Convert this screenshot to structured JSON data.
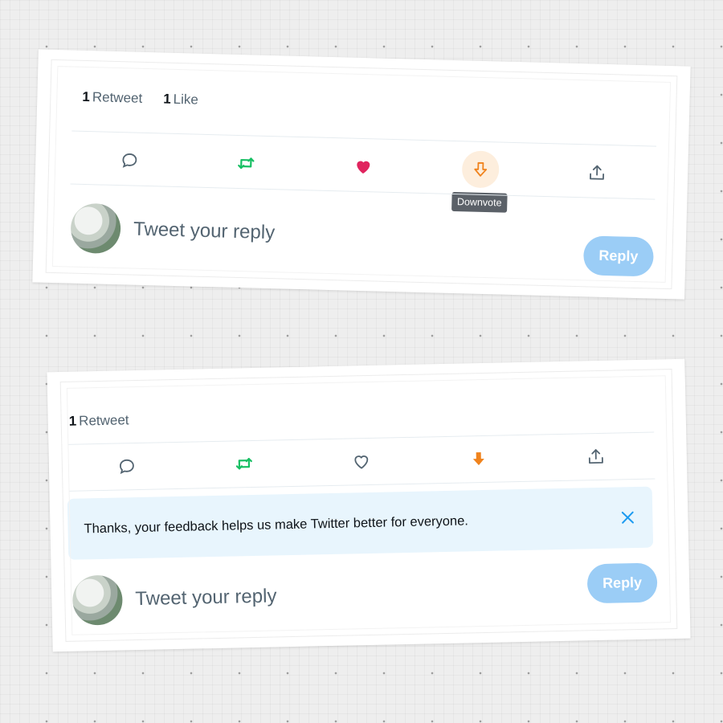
{
  "card_top": {
    "stats": {
      "retweet_count": "1",
      "retweet_label": "Retweet",
      "like_count": "1",
      "like_label": "Like"
    },
    "tooltip": "Downvote",
    "reply_placeholder": "Tweet your reply",
    "reply_button": "Reply"
  },
  "card_bottom": {
    "stats": {
      "retweet_count": "1",
      "retweet_label": "Retweet"
    },
    "feedback": "Thanks, your feedback helps us make Twitter better for everyone.",
    "reply_placeholder": "Tweet your reply",
    "reply_button": "Reply"
  },
  "colors": {
    "retweet_green": "#17bf63",
    "like_pink": "#e0245e",
    "downvote_orange": "#f0831d",
    "reply_blue": "#9bcdf6",
    "close_blue": "#1d9bf0"
  },
  "icons": [
    "reply-icon",
    "retweet-icon",
    "like-icon",
    "downvote-icon",
    "share-icon",
    "close-icon"
  ]
}
